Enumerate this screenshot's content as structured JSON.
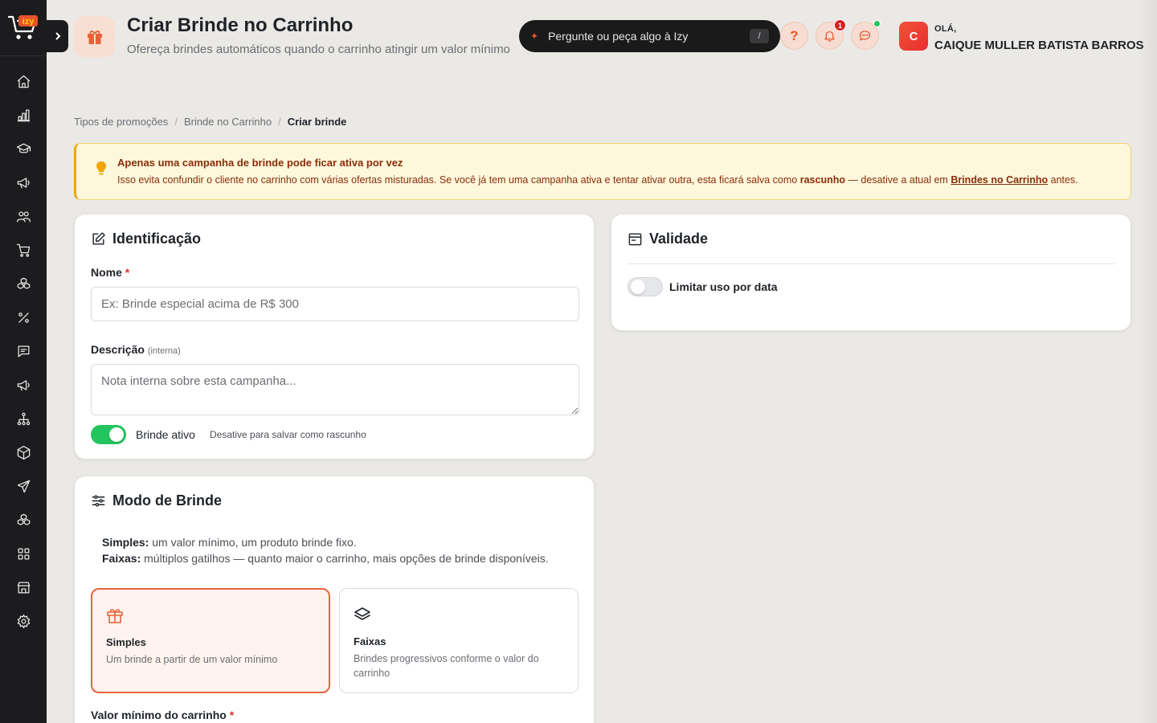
{
  "sidebar": {
    "logo_text": "izy",
    "items": [
      "home-icon",
      "bar-chart-icon",
      "graduation-cap-icon",
      "megaphone-icon",
      "users-icon",
      "cart-icon",
      "boxes-icon",
      "percent-icon",
      "message-icon",
      "megaphone-icon",
      "network-icon",
      "package-icon",
      "send-icon",
      "boxes-icon",
      "grid-icon",
      "store-icon",
      "gear-icon"
    ]
  },
  "header": {
    "title": "Criar Brinde no Carrinho",
    "subtitle": "Ofereça brindes automáticos quando o carrinho atingir um valor mínimo",
    "ask_placeholder": "Pergunte ou peça algo à Izy",
    "ask_shortcut": "/",
    "help_label": "?",
    "notifications_count": "1",
    "greeting": "OLÁ,",
    "user_name": "CAIQUE MULLER BATISTA BARROS",
    "avatar_initial": "C"
  },
  "breadcrumb": {
    "items": [
      "Tipos de promoções",
      "Brinde no Carrinho"
    ],
    "separator": "/",
    "current": "Criar brinde"
  },
  "alert": {
    "title": "Apenas uma campanha de brinde pode ficar ativa por vez",
    "body_1": "Isso evita confundir o cliente no carrinho com várias ofertas misturadas. Se você já tem uma campanha ativa e tentar ativar outra, esta ficará salva como ",
    "body_bold": "rascunho",
    "body_2": " — desative a atual em ",
    "body_link": "Brindes no Carrinho",
    "body_3": " antes."
  },
  "identificacao": {
    "title": "Identificação",
    "nome_label": "Nome",
    "required_mark": "*",
    "nome_placeholder": "Ex: Brinde especial acima de R$ 300",
    "descricao_label": "Descrição",
    "descricao_hint": "(interna)",
    "descricao_placeholder": "Nota interna sobre esta campanha...",
    "ativo_label": "Brinde ativo",
    "ativo_hint": "Desative para salvar como rascunho",
    "ativo_on": true
  },
  "validade": {
    "title": "Validade",
    "limitar_label": "Limitar uso por data",
    "limitar_on": false
  },
  "modo": {
    "title": "Modo de Brinde",
    "simples_term": "Simples:",
    "simples_desc": " um valor mínimo, um produto brinde fixo.",
    "faixas_term": "Faixas:",
    "faixas_desc": " múltiplos gatilhos — quanto maior o carrinho, mais opções de brinde disponíveis.",
    "options": [
      {
        "title": "Simples",
        "desc": "Um brinde a partir de um valor mínimo",
        "icon": "gift-icon",
        "selected": true
      },
      {
        "title": "Faixas",
        "desc": "Brindes progressivos conforme o valor do carrinho",
        "icon": "layers-icon",
        "selected": false
      }
    ],
    "valor_minimo_label": "Valor mínimo do carrinho"
  },
  "colors": {
    "accent": "#e8633a",
    "sidebar_bg": "#1c1c1e",
    "success": "#22c55e",
    "alert_bg": "#fdf7dc"
  }
}
